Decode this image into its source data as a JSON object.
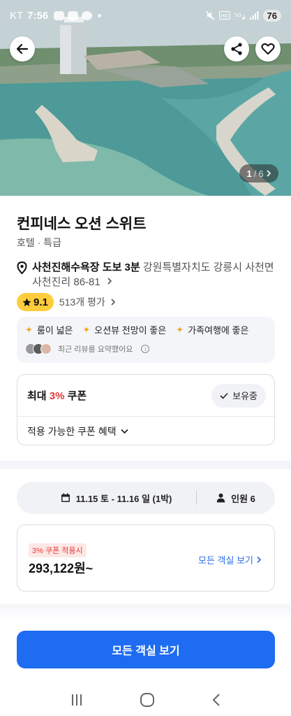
{
  "status_bar": {
    "carrier": "KT",
    "time": "7:56",
    "battery": "76"
  },
  "hero": {
    "photo_counter": {
      "current": "1",
      "separator": "/",
      "total": "6"
    }
  },
  "hotel": {
    "name": "컨피네스 오션 스위트",
    "category": "호텔 · 특급",
    "location_highlight": "사천진해수욕장 도보 3분",
    "address": "강원특별자치도 강릉시 사천면 사천진리 86-81",
    "rating": "9.1",
    "review_count": "513개 평가"
  },
  "review_keywords": [
    "룸이 넓은",
    "오션뷰 전망이 좋은",
    "가족여행에 좋은"
  ],
  "review_summary": "최근 리뷰를 요약했어요",
  "coupon": {
    "label_prefix": "최대 ",
    "percent": "3%",
    "label_suffix": " 쿠폰",
    "owned_label": "보유중",
    "benefits_label": "적용 가능한 쿠폰 혜택"
  },
  "booking": {
    "dates": "11.15 토 - 11.16 일 (1박)",
    "guests": "인원 6"
  },
  "price": {
    "coupon_tag": "3% 쿠폰 적용시",
    "amount": "293,122원~",
    "link": "모든 객실 보기"
  },
  "cta": {
    "label": "모든 객실 보기"
  },
  "colors": {
    "accent": "#1e6cf2",
    "coupon_red": "#e53935",
    "rating_yellow": "#ffcd3c"
  }
}
